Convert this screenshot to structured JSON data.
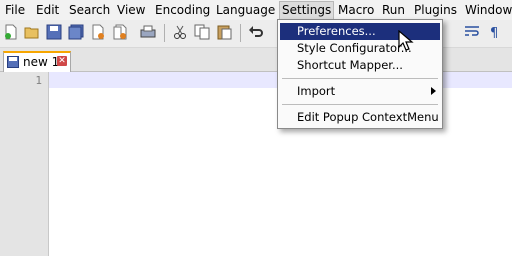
{
  "menubar": {
    "items": [
      {
        "label": "File"
      },
      {
        "label": "Edit"
      },
      {
        "label": "Search"
      },
      {
        "label": "View"
      },
      {
        "label": "Encoding"
      },
      {
        "label": "Language"
      },
      {
        "label": "Settings"
      },
      {
        "label": "Macro"
      },
      {
        "label": "Run"
      },
      {
        "label": "Plugins"
      },
      {
        "label": "Window"
      }
    ],
    "active": "Settings"
  },
  "toolbar": {
    "icons": [
      "new-file-icon",
      "open-file-icon",
      "save-icon",
      "save-all-icon",
      "close-icon",
      "close-all-icon",
      "print-icon",
      "cut-icon",
      "copy-icon",
      "paste-icon",
      "undo-icon",
      "wrap-icon",
      "show-all-characters-icon"
    ]
  },
  "tabs": [
    {
      "label": "new 1",
      "icon": "document-icon",
      "close_icon": "close-tab-icon",
      "close_glyph": "✕"
    }
  ],
  "editor": {
    "line_numbers": [
      "1"
    ]
  },
  "settings_menu": {
    "items": [
      {
        "label": "Preferences...",
        "highlighted": true
      },
      {
        "label": "Style Configurator..."
      },
      {
        "label": "Shortcut Mapper..."
      },
      {
        "label": "Import",
        "submenu": true
      },
      {
        "label": "Edit Popup ContextMenu"
      }
    ]
  },
  "colors": {
    "menu_highlight": "#1c2f7c",
    "active_tab_accent": "#f7a600",
    "current_line": "#e8e8ff"
  }
}
